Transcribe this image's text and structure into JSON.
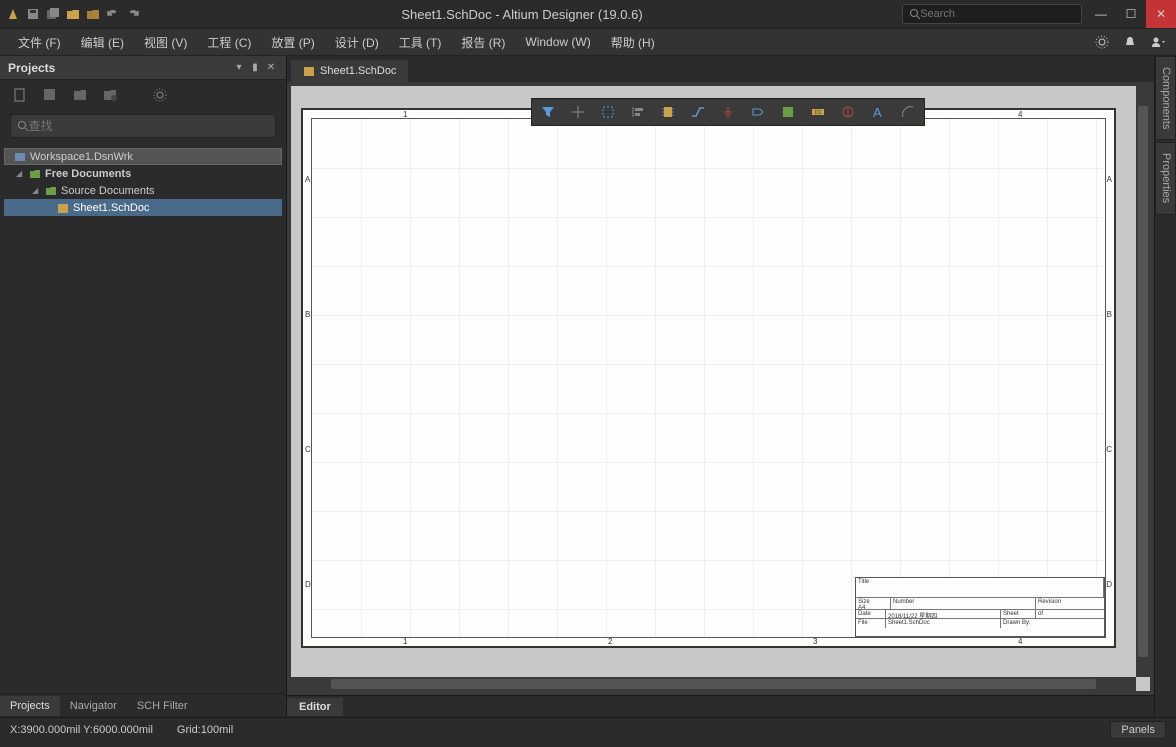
{
  "title_bar": {
    "app_title": "Sheet1.SchDoc - Altium Designer (19.0.6)",
    "search_placeholder": "Search"
  },
  "window_controls": {
    "min": "—",
    "max": "☐",
    "close": "✕"
  },
  "menu": {
    "file": "文件 (F)",
    "edit": "编辑 (E)",
    "view": "视图 (V)",
    "project": "工程 (C)",
    "place": "放置 (P)",
    "design": "设计 (D)",
    "tools": "工具 (T)",
    "report": "报告 (R)",
    "window": "Window (W)",
    "help": "帮助 (H)"
  },
  "projects": {
    "title": "Projects",
    "search_placeholder": "查找",
    "tree": {
      "workspace": "Workspace1.DsnWrk",
      "free_docs": "Free Documents",
      "source_docs": "Source Documents",
      "sheet": "Sheet1.SchDoc"
    },
    "tabs": {
      "projects": "Projects",
      "navigator": "Navigator",
      "sch_filter": "SCH Filter"
    }
  },
  "doc_tab": {
    "name": "Sheet1.SchDoc"
  },
  "sheet": {
    "cols": [
      "1",
      "2",
      "3",
      "4"
    ],
    "rows": [
      "A",
      "B",
      "C",
      "D"
    ],
    "title_block": {
      "title_lbl": "Title",
      "size_lbl": "Size",
      "size_val": "A4",
      "number_lbl": "Number",
      "rev_lbl": "Revision",
      "date_lbl": "Date",
      "date_val": "2018/11/22 星期四",
      "sheet_lbl": "Sheet",
      "of_lbl": "of",
      "file_lbl": "File",
      "file_val": "Sheet1.SchDoc",
      "drawn_lbl": "Drawn By:"
    }
  },
  "right_tabs": {
    "components": "Components",
    "properties": "Properties"
  },
  "editor_tab": "Editor",
  "status": {
    "coords": "X:3900.000mil Y:6000.000mil",
    "grid": "Grid:100mil",
    "panels": "Panels"
  },
  "colors": {
    "close_btn": "#c43434",
    "selected": "#4a6a8a"
  }
}
